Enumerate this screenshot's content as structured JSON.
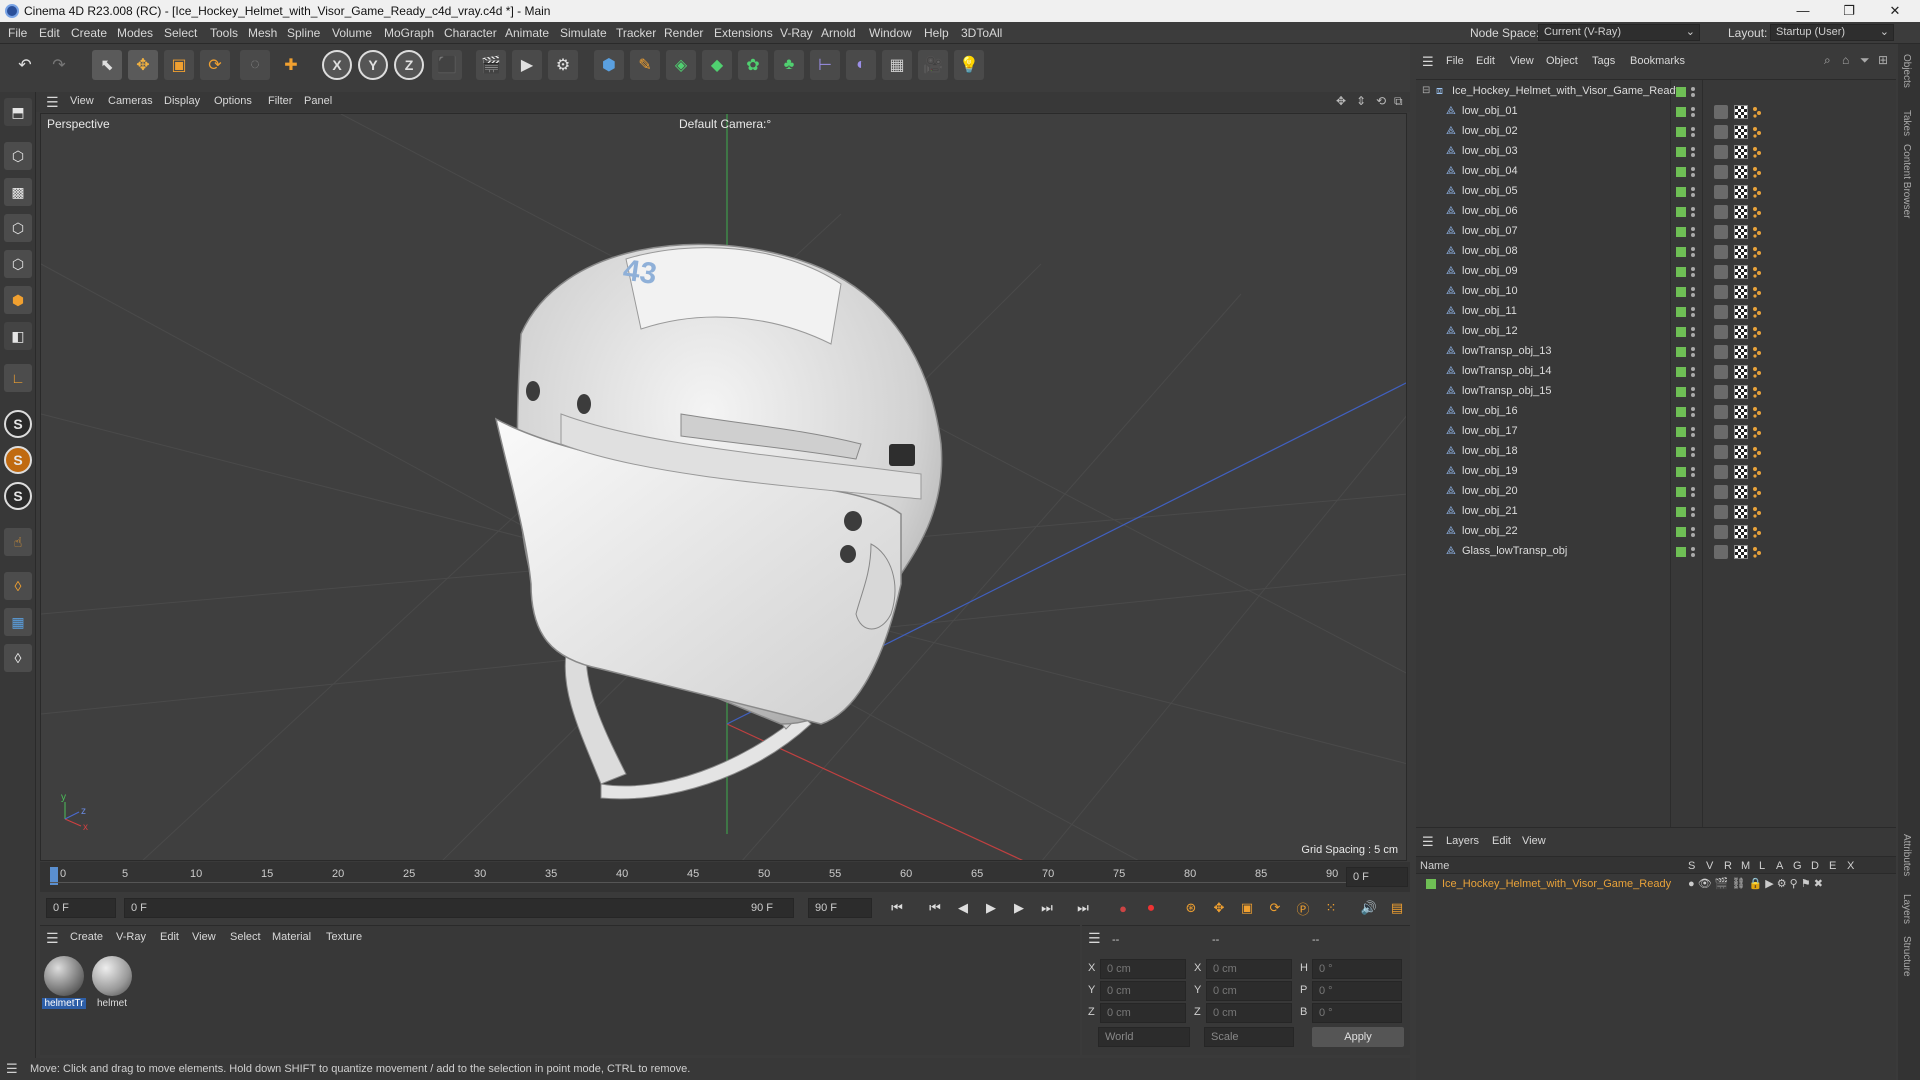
{
  "window": {
    "title": "Cinema 4D R23.008 (RC) - [Ice_Hockey_Helmet_with_Visor_Game_Ready_c4d_vray.c4d *] - Main",
    "minimize": "—",
    "maximize": "❐",
    "close": "✕"
  },
  "menu": [
    "File",
    "Edit",
    "Create",
    "Modes",
    "Select",
    "Tools",
    "Mesh",
    "Spline",
    "Volume",
    "MoGraph",
    "Character",
    "Animate",
    "Simulate",
    "Tracker",
    "Render",
    "Extensions",
    "V-Ray",
    "Arnold",
    "Window",
    "Help",
    "3DToAll"
  ],
  "nodespace": {
    "label": "Node Space:",
    "value": "Current (V-Ray)"
  },
  "layout": {
    "label": "Layout:",
    "value": "Startup (User)"
  },
  "viewport": {
    "menu": [
      "View",
      "Cameras",
      "Display",
      "Options",
      "Filter",
      "Panel"
    ],
    "label": "Perspective",
    "camera": "Default Camera",
    "camera_suffix": ":°",
    "grid": "Grid Spacing : 5 cm",
    "helmet_number": "43"
  },
  "timeline": {
    "ticks": [
      "0",
      "5",
      "10",
      "15",
      "20",
      "25",
      "30",
      "35",
      "40",
      "45",
      "50",
      "55",
      "60",
      "65",
      "70",
      "75",
      "80",
      "85",
      "90"
    ],
    "current": "0 F",
    "start": "0 F",
    "range_start": "0 F",
    "range_end": "90 F",
    "end": "90 F"
  },
  "material_panel": {
    "menu": [
      "Create",
      "V-Ray",
      "Edit",
      "View",
      "Select",
      "Material",
      "Texture"
    ],
    "materials": [
      "helmetTr",
      "helmet"
    ]
  },
  "coords": {
    "headers": [
      "--",
      "--",
      "--"
    ],
    "rows": [
      {
        "a": "X",
        "av": "0 cm",
        "b": "X",
        "bv": "0 cm",
        "c": "H",
        "cv": "0 °"
      },
      {
        "a": "Y",
        "av": "0 cm",
        "b": "Y",
        "bv": "0 cm",
        "c": "P",
        "cv": "0 °"
      },
      {
        "a": "Z",
        "av": "0 cm",
        "b": "Z",
        "bv": "0 cm",
        "c": "B",
        "cv": "0 °"
      }
    ],
    "world": "World",
    "scale": "Scale",
    "apply": "Apply"
  },
  "status": "Move: Click and drag to move elements. Hold down SHIFT to quantize movement / add to the selection in point mode, CTRL to remove.",
  "objects": {
    "menu": [
      "File",
      "Edit",
      "View",
      "Object",
      "Tags",
      "Bookmarks"
    ],
    "root": "Ice_Hockey_Helmet_with_Visor_Game_Ready",
    "items": [
      "low_obj_01",
      "low_obj_02",
      "low_obj_03",
      "low_obj_04",
      "low_obj_05",
      "low_obj_06",
      "low_obj_07",
      "low_obj_08",
      "low_obj_09",
      "low_obj_10",
      "low_obj_11",
      "low_obj_12",
      "lowTransp_obj_13",
      "lowTransp_obj_14",
      "lowTransp_obj_15",
      "low_obj_16",
      "low_obj_17",
      "low_obj_18",
      "low_obj_19",
      "low_obj_20",
      "low_obj_21",
      "low_obj_22",
      "Glass_lowTransp_obj"
    ]
  },
  "layers": {
    "menu": [
      "Layers",
      "Edit",
      "View"
    ],
    "name_col": "Name",
    "flags": [
      "S",
      "V",
      "R",
      "M",
      "L",
      "A",
      "G",
      "D",
      "E",
      "X"
    ],
    "row": "Ice_Hockey_Helmet_with_Visor_Game_Ready"
  },
  "side_tabs": [
    "Objects",
    "Takes",
    "Content Browser",
    "Attributes",
    "Layers",
    "Structure"
  ],
  "colors": {
    "accent_orange": "#e8a23a",
    "green": "#6fbf55"
  }
}
